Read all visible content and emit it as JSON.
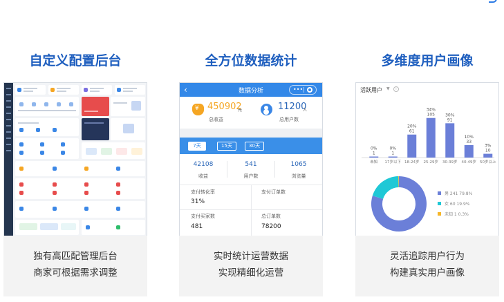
{
  "columns": [
    {
      "title": "自定义配置后台",
      "caption": [
        "独有高匹配管理后台",
        "商家可根据需求调整"
      ]
    },
    {
      "title": "全方位数据统计",
      "caption": [
        "实时统计运营数据",
        "实现精细化运营"
      ]
    },
    {
      "title": "多维度用户画像",
      "caption": [
        "灵活追踪用户行为",
        "构建真实用户画像"
      ]
    }
  ],
  "phone": {
    "header_title": "数据分析",
    "header_dots": "•••",
    "revenue_value": "450902",
    "revenue_unit": "元",
    "revenue_label": "总收益",
    "users_value": "11200",
    "users_unit": "人",
    "users_label": "总用户数",
    "periods": [
      "7天",
      "15天",
      "30天"
    ],
    "active_period": "7天",
    "stats": [
      {
        "value": "42108",
        "label": "收益"
      },
      {
        "value": "541",
        "label": "用户数"
      },
      {
        "value": "1065",
        "label": "浏览量"
      }
    ],
    "grid": [
      {
        "label": "支付转化率",
        "value": "31%"
      },
      {
        "label": "支付订单数",
        "value": ""
      },
      {
        "label": "支付买家数",
        "value": "481"
      },
      {
        "label": "总订单数",
        "value": "78200"
      }
    ],
    "colors": {
      "header": "#3388e8",
      "revenue": "#f5a623",
      "users": "#2a66b8"
    }
  },
  "users_panel": {
    "title": "活跃用户",
    "chart_data": [
      {
        "type": "bar",
        "categories": [
          "未知",
          "17岁以下",
          "18-24岁",
          "25-29岁",
          "30-39岁",
          "40-49岁",
          "50岁以上"
        ],
        "values": [
          1,
          1,
          61,
          105,
          91,
          33,
          10
        ],
        "percent_labels": [
          "0%",
          "0%",
          "20%",
          "34%",
          "30%",
          "10%",
          "3%"
        ],
        "value_labels": [
          "1",
          "1",
          "61",
          "105",
          "91",
          "33",
          "10"
        ],
        "ylim": [
          0,
          110
        ],
        "grid": false,
        "color": "#6b7fd8"
      },
      {
        "type": "pie",
        "style": "donut",
        "slices": [
          {
            "label": "男",
            "value": 241,
            "percent": "79.8%",
            "legend": "男 241 79.8%",
            "color": "#6b7fd8"
          },
          {
            "label": "女",
            "value": 60,
            "percent": "19.9%",
            "legend": "女 60 19.9%",
            "color": "#1fc8d6"
          },
          {
            "label": "未知",
            "value": 1,
            "percent": "1.3%",
            "legend": "未知 1 0.3%",
            "color": "#f6b628"
          }
        ],
        "legend_placement": "right"
      }
    ]
  }
}
